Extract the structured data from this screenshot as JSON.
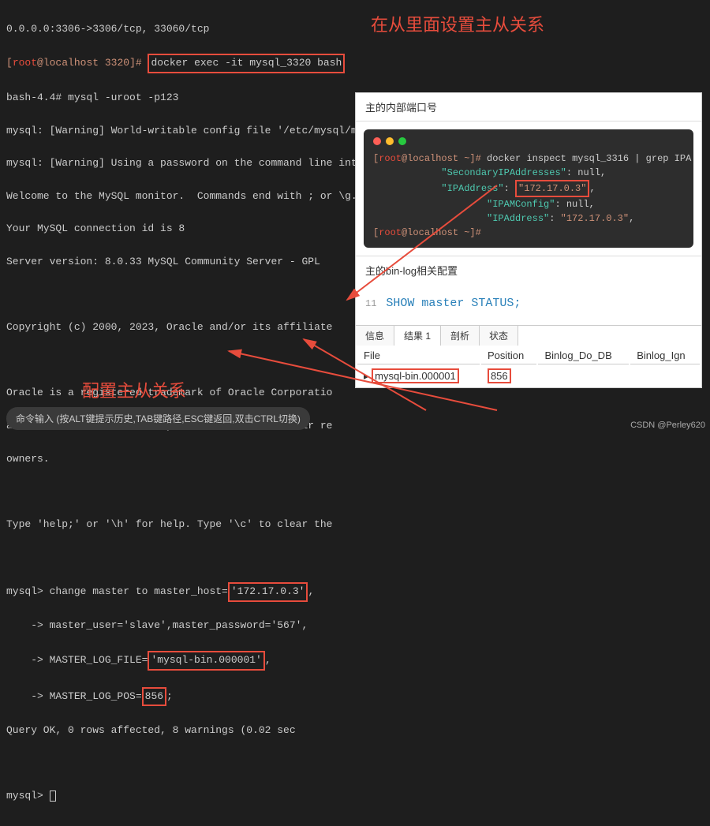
{
  "terminal": {
    "l0": "0.0.0.0:3306->3306/tcp, 33060/tcp",
    "l1a": "[root@localhost 3320]# ",
    "l1b": "docker exec -it mysql_3320 bash",
    "l2": "bash-4.4# mysql -uroot -p123",
    "l3": "mysql: [Warning] World-writable config file '/etc/mysql/my.cnf' is ignored.",
    "l4": "mysql: [Warning] Using a password on the command line interface can be insecure.",
    "l5": "Welcome to the MySQL monitor.  Commands end with ; or \\g.",
    "l6": "Your MySQL connection id is 8",
    "l7": "Server version: 8.0.33 MySQL Community Server - GPL",
    "l8": "",
    "l9": "Copyright (c) 2000, 2023, Oracle and/or its affiliate",
    "l10": "",
    "l11": "Oracle is a registered trademark of Oracle Corporatio",
    "l12": "affiliates. Other names may be trademarks of their re",
    "l13": "owners.",
    "l14": "",
    "l15": "Type 'help;' or '\\h' for help. Type '\\c' to clear the",
    "l16": "",
    "l17a": "mysql> change master to master_host=",
    "l17b": "'172.17.0.3'",
    "l17c": ",",
    "l18": "    -> master_user='slave',master_password='567',",
    "l19a": "    -> MASTER_LOG_FILE=",
    "l19b": "'mysql-bin.000001'",
    "l19c": ",",
    "l20a": "    -> MASTER_LOG_POS=",
    "l20b": "856",
    "l20c": ";",
    "l21": "Query OK, 0 rows affected, 8 warnings (0.02 sec",
    "l22": "",
    "l23": "mysql> "
  },
  "annotations": {
    "a1": "在从里面设置主从关系",
    "a2": "配置主从关系"
  },
  "overlay": {
    "header1": "主的内部端口号",
    "inner": {
      "prompt1a": "[",
      "prompt1b": "root@localhost",
      "prompt1c": " ~]# ",
      "cmd1": "docker inspect mysql_3316 | grep IPA",
      "out1a": "            \"SecondaryIPAddresses\"",
      "out1b": ": null,",
      "out2a": "            \"IPAddress\"",
      "out2b": ": ",
      "out2c": "\"172.17.0.3\"",
      "out2d": ",",
      "out3a": "                    \"IPAMConfig\"",
      "out3b": ": null,",
      "out4a": "                    \"IPAddress\"",
      "out4b": ": ",
      "out4c": "\"172.17.0.3\"",
      "out4d": ",",
      "prompt2a": "[",
      "prompt2b": "root@localhost",
      "prompt2c": " ~]# "
    },
    "header2": "主的bin-log相关配置",
    "sql_linenum": "11",
    "sql": "SHOW master STATUS;",
    "tabs": [
      "信息",
      "结果 1",
      "剖析",
      "状态"
    ],
    "table": {
      "headers": [
        "File",
        "Position",
        "Binlog_Do_DB",
        "Binlog_Ign"
      ],
      "row": [
        "mysql-bin.000001",
        "856",
        "",
        ""
      ]
    }
  },
  "bottom_hint": "命令输入 (按ALT键提示历史,TAB键路径,ESC键返回,双击CTRL切换)",
  "watermark": "CSDN @Perley620",
  "chart_data": {
    "type": "table",
    "title": "SHOW master STATUS",
    "headers": [
      "File",
      "Position",
      "Binlog_Do_DB",
      "Binlog_Ign"
    ],
    "rows": [
      [
        "mysql-bin.000001",
        856,
        "",
        ""
      ]
    ]
  }
}
